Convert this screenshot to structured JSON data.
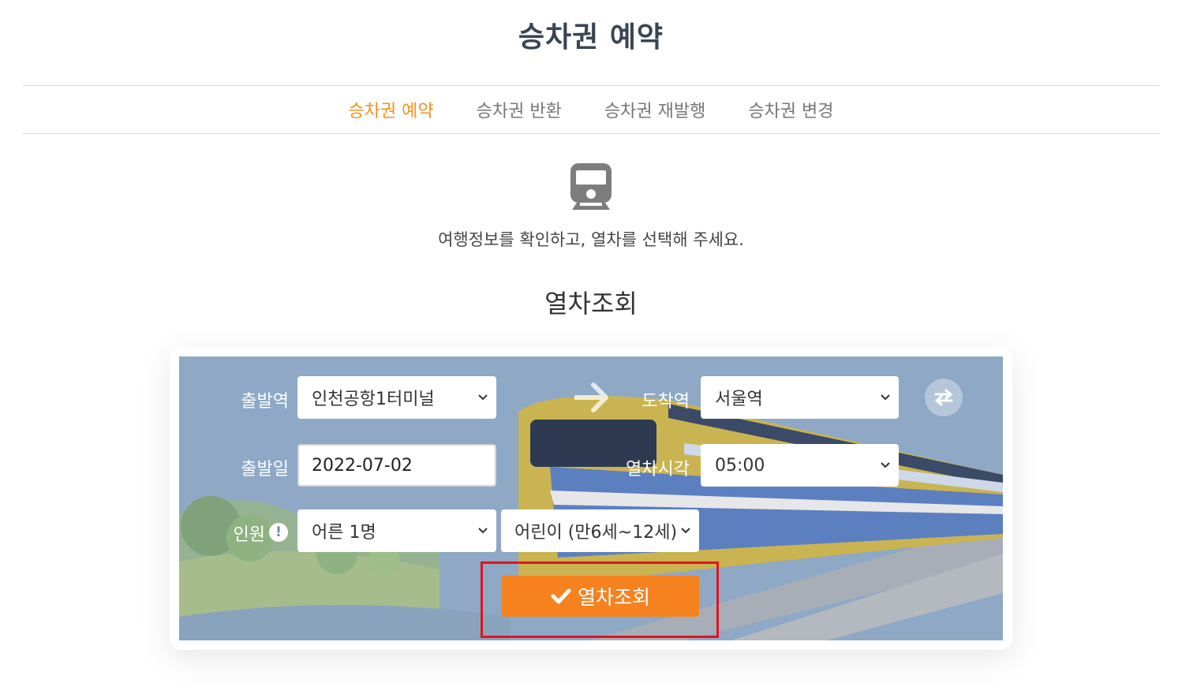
{
  "page": {
    "title": "승차권 예약"
  },
  "tabs": [
    {
      "label": "승차권 예약",
      "active": true
    },
    {
      "label": "승차권 반환",
      "active": false
    },
    {
      "label": "승차권 재발행",
      "active": false
    },
    {
      "label": "승차권 변경",
      "active": false
    }
  ],
  "guide": {
    "icon": "train-icon",
    "text": "여행정보를 확인하고, 열차를 선택해 주세요."
  },
  "search": {
    "section_title": "열차조회",
    "departure_label": "출발역",
    "departure_value": "인천공항1터미널",
    "arrival_label": "도착역",
    "arrival_value": "서울역",
    "date_label": "출발일",
    "date_value": "2022-07-02",
    "time_label": "열차시각",
    "time_value": "05:00",
    "passenger_label": "인원",
    "adult_value": "어른 1명",
    "child_value": "어린이 (만6세~12세)",
    "submit_label": "열차조회",
    "swap_icon": "swap-icon",
    "check_icon": "check-icon"
  },
  "colors": {
    "accent": "#f6921e",
    "button": "#f5821f",
    "panel_overlay": "#8ea8c6",
    "highlight": "#e0141e",
    "title": "#3a4552"
  }
}
